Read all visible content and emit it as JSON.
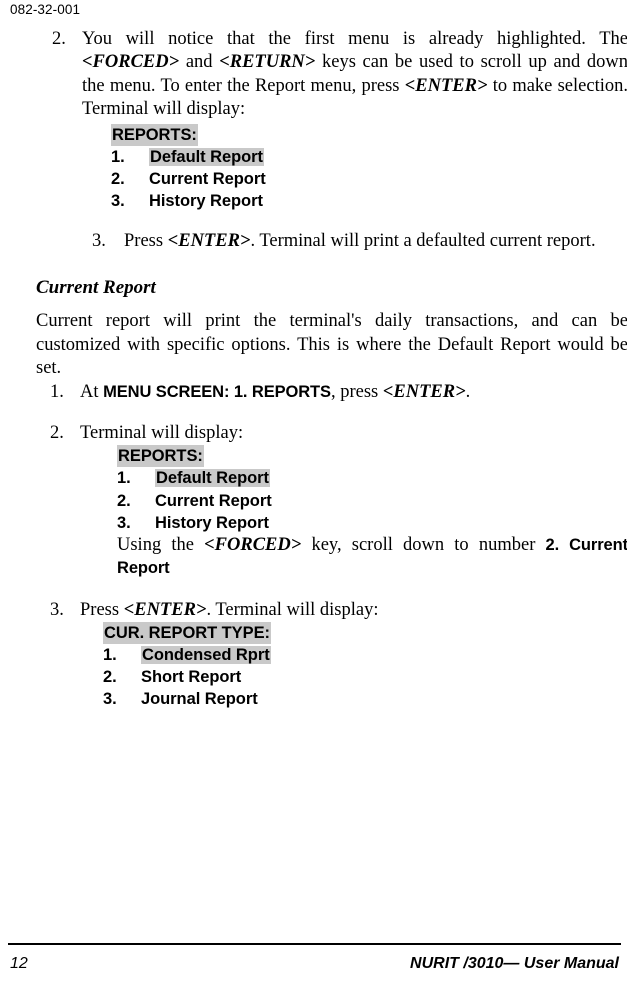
{
  "header": {
    "doc_number": "082-32-001"
  },
  "steps_top": {
    "step2": {
      "num": "2.",
      "text_a": "You will notice that the first menu is already highlighted. The ",
      "key_forced": "<FORCED>",
      "text_b": " and ",
      "key_return": "<RETURN>",
      "text_c": " keys can be used to scroll up and down the menu.  To enter the Report menu, press ",
      "key_enter": "<ENTER>",
      "text_d": " to make selection. Terminal will display:"
    },
    "step3": {
      "num": "3.",
      "text_a": "Press ",
      "key_enter": "<ENTER>",
      "text_b": ". Terminal will print a defaulted current report."
    }
  },
  "screen_reports_1": {
    "title": "REPORTS:",
    "title_highlighted": true,
    "rows": [
      {
        "idx": "1.",
        "label": "Default Report",
        "highlighted": true
      },
      {
        "idx": "2.",
        "label": "Current Report",
        "highlighted": false
      },
      {
        "idx": "3.",
        "label": "History Report",
        "highlighted": false
      }
    ]
  },
  "section": {
    "heading": "Current Report",
    "paragraph": "Current report will print the terminal's daily transactions, and can be customized with specific options.  This is where the Default Report would be set."
  },
  "steps_bottom": {
    "step1": {
      "num": "1.",
      "text_a": "At  ",
      "screen_ref": "MENU SCREEN: 1. REPORTS",
      "text_b": ", press ",
      "key_enter": "<ENTER>",
      "text_c": "."
    },
    "step2": {
      "num": "2.",
      "text": "Terminal will display:",
      "trailer_a": "Using the ",
      "trailer_key": "<FORCED>",
      "trailer_b": " key, scroll down to number ",
      "trailer_ref": "2. Current Report"
    },
    "step3": {
      "num": "3.",
      "text_a": "Press ",
      "key_enter": "<ENTER>",
      "text_b": ".  Terminal will display:"
    }
  },
  "screen_reports_2": {
    "title": "REPORTS:",
    "title_highlighted": true,
    "rows": [
      {
        "idx": "1.",
        "label": "Default Report",
        "highlighted": true
      },
      {
        "idx": "2.",
        "label": "Current Report",
        "highlighted": false
      },
      {
        "idx": "3.",
        "label": "History Report",
        "highlighted": false
      }
    ]
  },
  "screen_cur_report_type": {
    "title": "CUR. REPORT TYPE:",
    "title_highlighted": true,
    "rows": [
      {
        "idx": "1.",
        "label": "Condensed Rprt",
        "highlighted": true
      },
      {
        "idx": "2.",
        "label": "Short Report",
        "highlighted": false
      },
      {
        "idx": "3.",
        "label": "Journal Report",
        "highlighted": false
      }
    ]
  },
  "footer": {
    "page_number": "12",
    "manual_title": "NURIT /3010— User Manual"
  },
  "colors": {
    "highlight": "#c9c9c9",
    "text": "#000000",
    "background": "#ffffff"
  }
}
